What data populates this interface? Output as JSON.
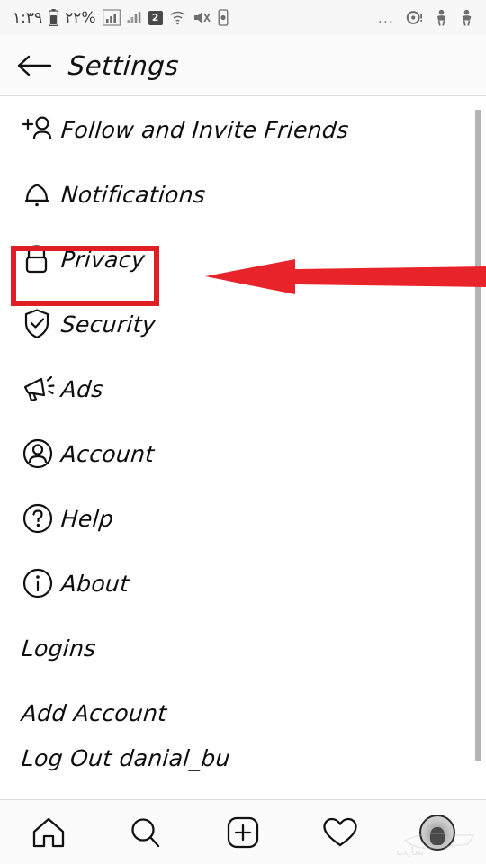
{
  "statusbar": {
    "clock": "۱:۳۹",
    "battery_pct": "۲۲%",
    "sim_badge": "2",
    "icons": [
      "battery-icon",
      "signal-bars-icon",
      "signal-bars-secondary-icon",
      "sim-badge-icon",
      "wifi-icon",
      "mute-icon",
      "vibrate-icon"
    ],
    "right_icons": [
      "ellipsis-icon",
      "alarm-icon",
      "person-a-icon",
      "person-b-icon"
    ],
    "ellipsis": "..."
  },
  "header": {
    "back_icon": "back-arrow-icon",
    "title": "Settings"
  },
  "menu": {
    "items": [
      {
        "label": "Follow and Invite Friends",
        "icon": "add-person-icon"
      },
      {
        "label": "Notifications",
        "icon": "bell-icon"
      },
      {
        "label": "Privacy",
        "icon": "lock-icon"
      },
      {
        "label": "Security",
        "icon": "shield-check-icon"
      },
      {
        "label": "Ads",
        "icon": "megaphone-icon"
      },
      {
        "label": "Account",
        "icon": "account-circle-icon"
      },
      {
        "label": "Help",
        "icon": "question-circle-icon"
      },
      {
        "label": "About",
        "icon": "info-circle-icon"
      },
      {
        "label": "Logins",
        "icon": ""
      },
      {
        "label": "Add Account",
        "icon": ""
      },
      {
        "label": "Log Out danial_bu",
        "icon": ""
      }
    ]
  },
  "annotation": {
    "highlight_target": "Privacy",
    "color": "#e01e26",
    "arrow_direction": "left",
    "shapes": [
      "highlight-rectangle",
      "pointer-arrow"
    ]
  },
  "bottomnav": {
    "items": [
      {
        "name": "home-icon",
        "label": "Home"
      },
      {
        "name": "search-icon",
        "label": "Search"
      },
      {
        "name": "add-post-icon",
        "label": "Add"
      },
      {
        "name": "heart-icon",
        "label": "Activity"
      },
      {
        "name": "profile-avatar",
        "label": "Profile"
      }
    ]
  },
  "watermark": {
    "text": "سایت"
  }
}
